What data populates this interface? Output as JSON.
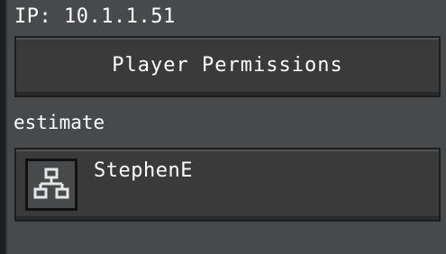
{
  "header": {
    "ip_label": "IP: 10.1.1.51"
  },
  "buttons": {
    "player_permissions_label": "Player Permissions"
  },
  "section": {
    "label": "estimate"
  },
  "players": [
    {
      "name": "StephenE",
      "icon": "network-icon"
    }
  ],
  "colors": {
    "panel_background": "#48494a",
    "button_background": "#3a3a3b",
    "text": "#ffffff"
  }
}
